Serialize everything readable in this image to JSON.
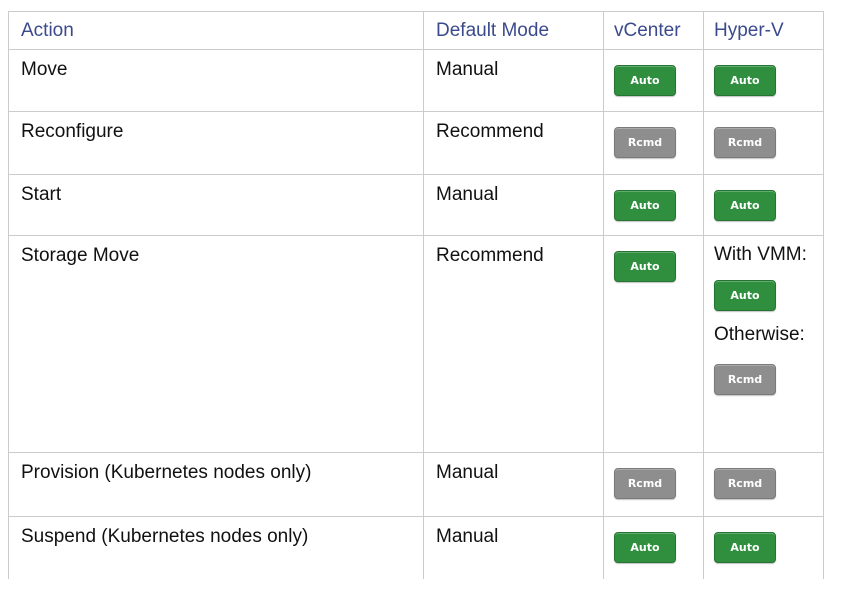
{
  "table": {
    "headers": {
      "action": "Action",
      "default_mode": "Default Mode",
      "vcenter": "vCenter",
      "hyperv": "Hyper-V"
    },
    "rows": [
      {
        "action": "Move",
        "default_mode": "Manual",
        "vcenter": "Auto",
        "hyperv": "Auto"
      },
      {
        "action": "Reconfigure",
        "default_mode": "Recommend",
        "vcenter": "Rcmd",
        "hyperv": "Rcmd"
      },
      {
        "action": "Start",
        "default_mode": "Manual",
        "vcenter": "Auto",
        "hyperv": "Auto"
      },
      {
        "action": "Storage Move",
        "default_mode": "Recommend",
        "vcenter": "Auto",
        "hyperv_with_vmm_label": "With VMM:",
        "hyperv_with_vmm": "Auto",
        "hyperv_otherwise_label": "Otherwise:",
        "hyperv_otherwise": "Rcmd"
      },
      {
        "action": "Provision (Kubernetes nodes only)",
        "default_mode": "Manual",
        "vcenter": "Rcmd",
        "hyperv": "Rcmd"
      },
      {
        "action": "Suspend (Kubernetes nodes only)",
        "default_mode": "Manual",
        "vcenter": "Auto",
        "hyperv": "Auto"
      }
    ]
  },
  "colors": {
    "header_text": "#3a4a8c",
    "auto_badge": "#2f8f3e",
    "rcmd_badge": "#8e8e8e",
    "border": "#cccccc"
  }
}
